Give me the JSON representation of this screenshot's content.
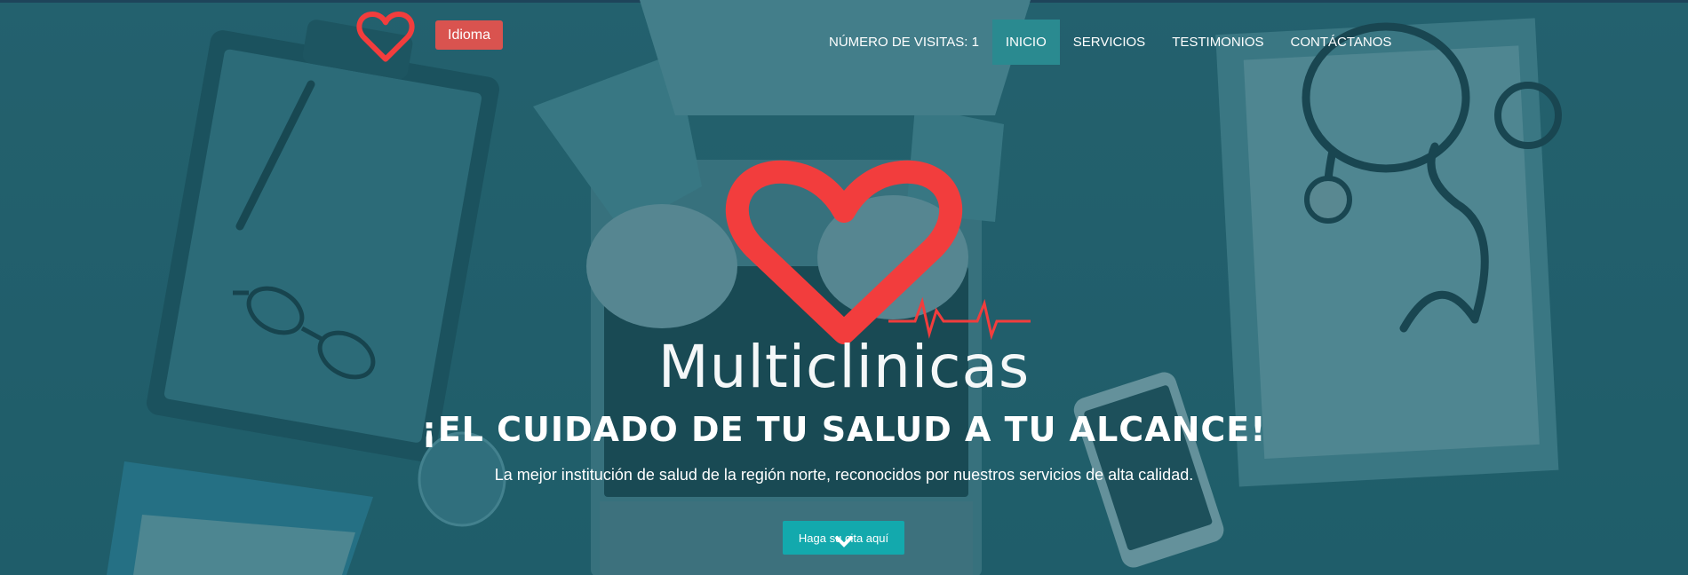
{
  "header": {
    "language_button": "Idioma",
    "nav": [
      {
        "label": "NÚMERO DE VISITAS: 1",
        "active": false
      },
      {
        "label": "INICIO",
        "active": true
      },
      {
        "label": "SERVICIOS",
        "active": false
      },
      {
        "label": "TESTIMONIOS",
        "active": false
      },
      {
        "label": "CONTÁCTANOS",
        "active": false
      }
    ]
  },
  "hero": {
    "brand_name": "Multiclinicas",
    "headline": "¡EL CUIDADO DE TU SALUD A TU ALCANCE!",
    "subtitle": "La mejor institución de salud de la región norte, reconocidos por nuestros servicios de alta calidad.",
    "cta_label": "Haga su cita aquí"
  },
  "colors": {
    "heart": "#f23d3d",
    "language_button": "#d9534f",
    "nav_active": "#2a8a90",
    "cta": "#13a9ad"
  },
  "icons": [
    "heart-logo-icon",
    "heartbeat-line-icon",
    "chevron-down-icon"
  ]
}
